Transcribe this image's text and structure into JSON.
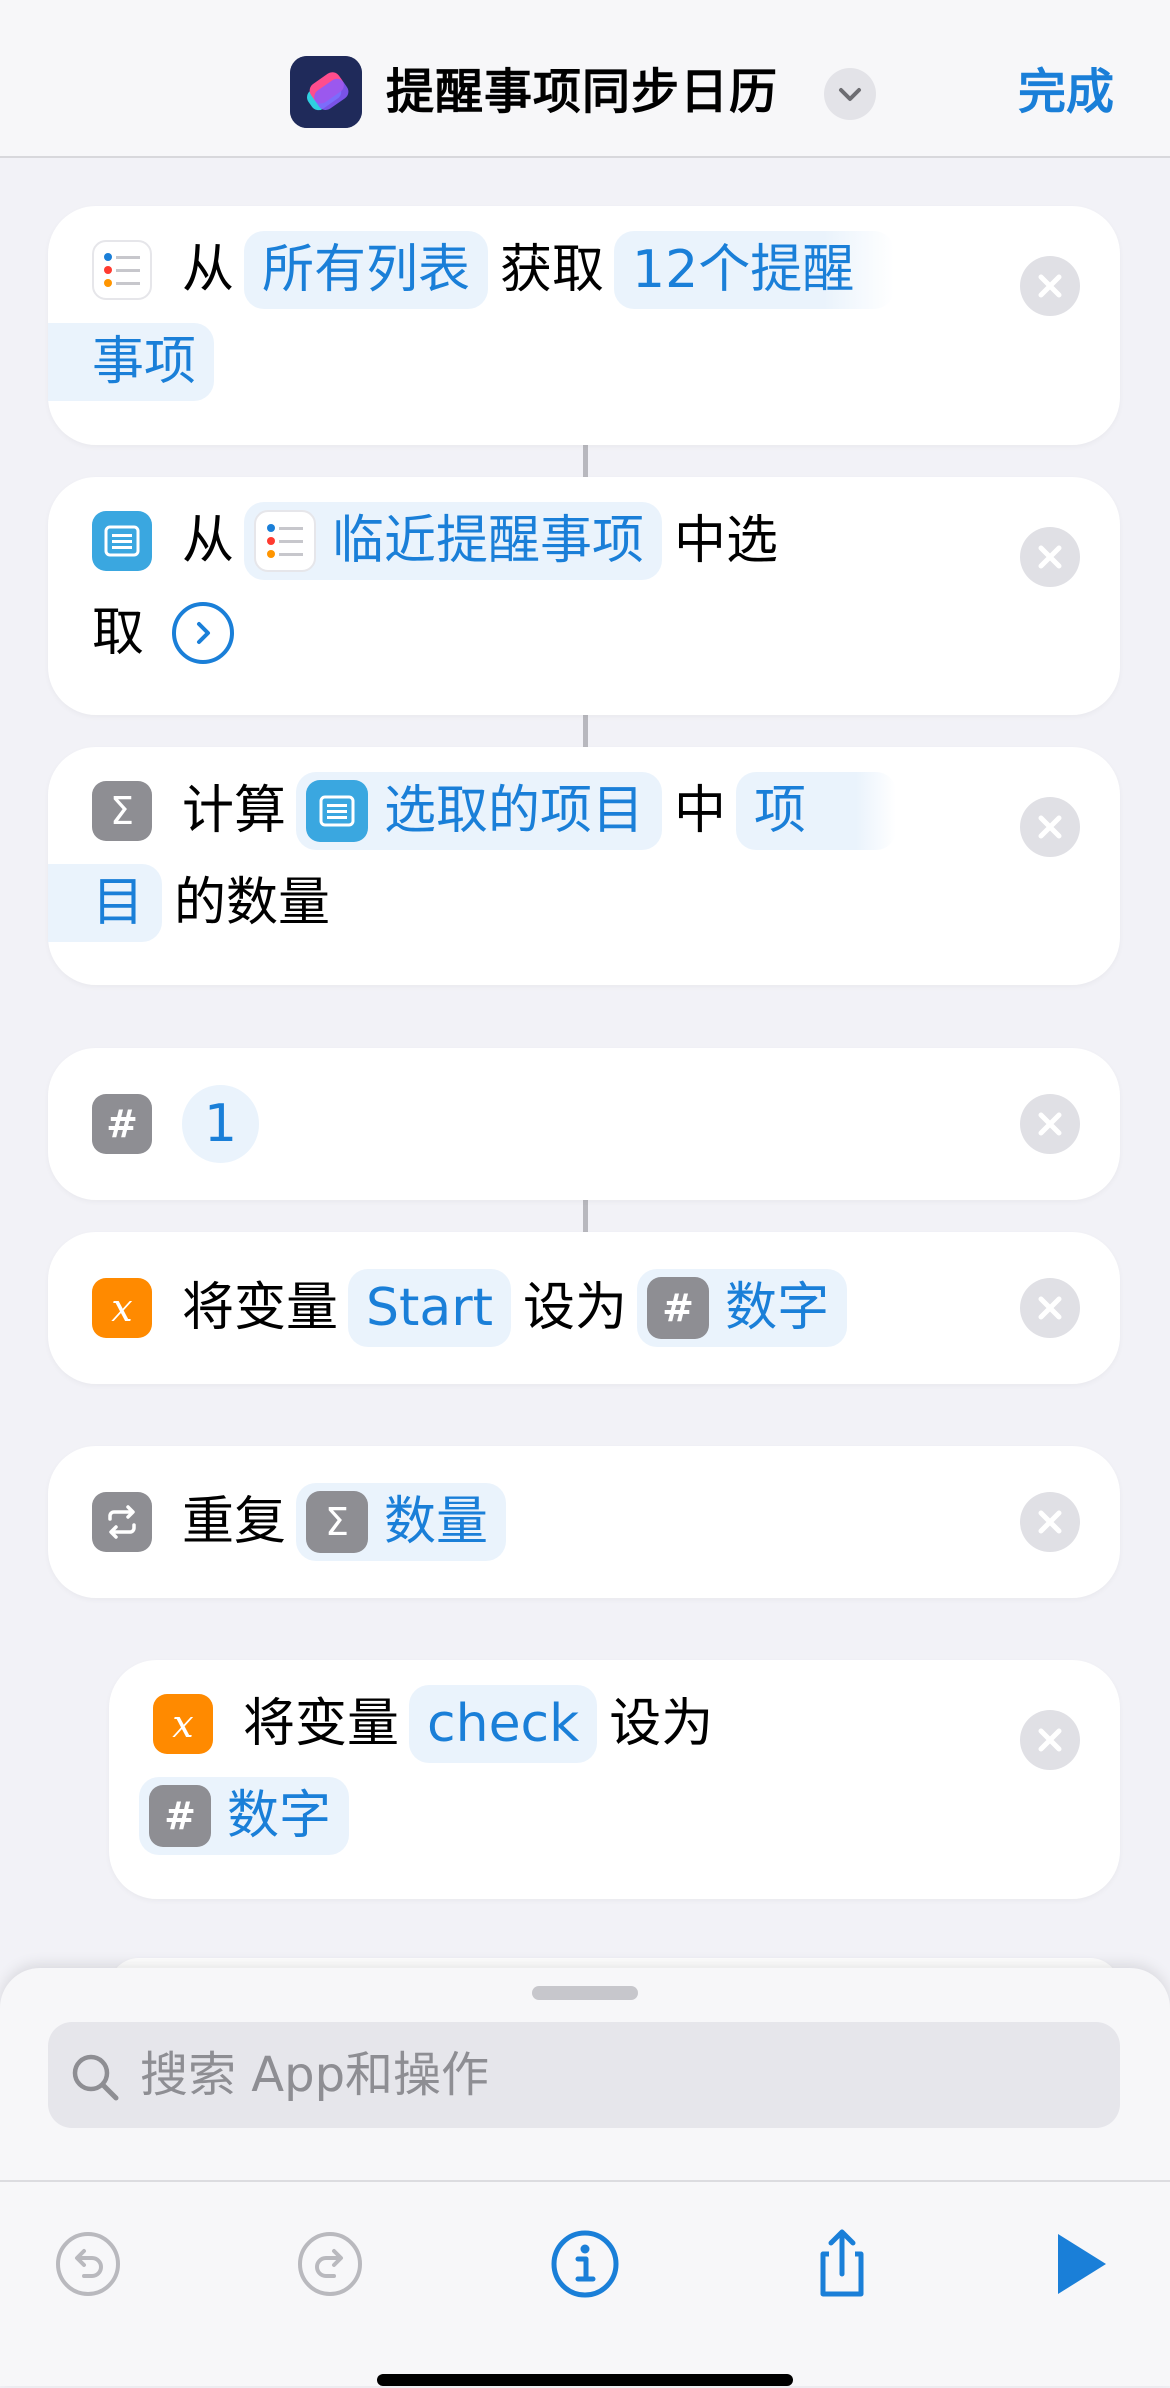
{
  "header": {
    "title": "提醒事项同步日历",
    "done_label": "完成"
  },
  "actions": [
    {
      "name": "get-reminders",
      "line1": {
        "from": "从",
        "list_token": "所有列表",
        "verb": "获取",
        "count_token": "12个提醒"
      },
      "line2": {
        "count_token_cont": "事项"
      }
    },
    {
      "name": "choose-from-list",
      "line1": {
        "from": "从",
        "source_token": "临近提醒事项",
        "verb": "中选"
      },
      "line2": {
        "verb_cont": "取"
      }
    },
    {
      "name": "count",
      "line1": {
        "verb": "计算",
        "source_token": "选取的项目",
        "in": "中",
        "type_token": "项"
      },
      "line2": {
        "type_token_cont": "目",
        "suffix": "的数量"
      }
    },
    {
      "name": "number",
      "icon_glyph": "#",
      "value": "1"
    },
    {
      "name": "set-variable-start",
      "icon_glyph": "x",
      "prefix": "将变量",
      "var_token": "Start",
      "verb": "设为",
      "value_token": "数字",
      "value_icon_glyph": "#"
    },
    {
      "name": "repeat",
      "verb": "重复",
      "count_token": "数量",
      "count_icon_glyph": "Σ"
    },
    {
      "name": "set-variable-check",
      "icon_glyph": "x",
      "prefix": "将变量",
      "var_token": "check",
      "verb": "设为",
      "value_token": "数字",
      "value_icon_glyph": "#"
    }
  ],
  "sigma_glyph": "Σ",
  "search": {
    "placeholder": "搜索 App和操作"
  },
  "toolbar": {
    "icons": [
      "undo-icon",
      "redo-icon",
      "info-icon",
      "share-icon",
      "play-icon"
    ]
  },
  "colors": {
    "accent": "#1a7fd8",
    "token_bg": "#eaf3fc",
    "variable_orange": "#ff8a00",
    "gray_icon": "#8e8e93",
    "list_blue": "#3aa7e0"
  }
}
